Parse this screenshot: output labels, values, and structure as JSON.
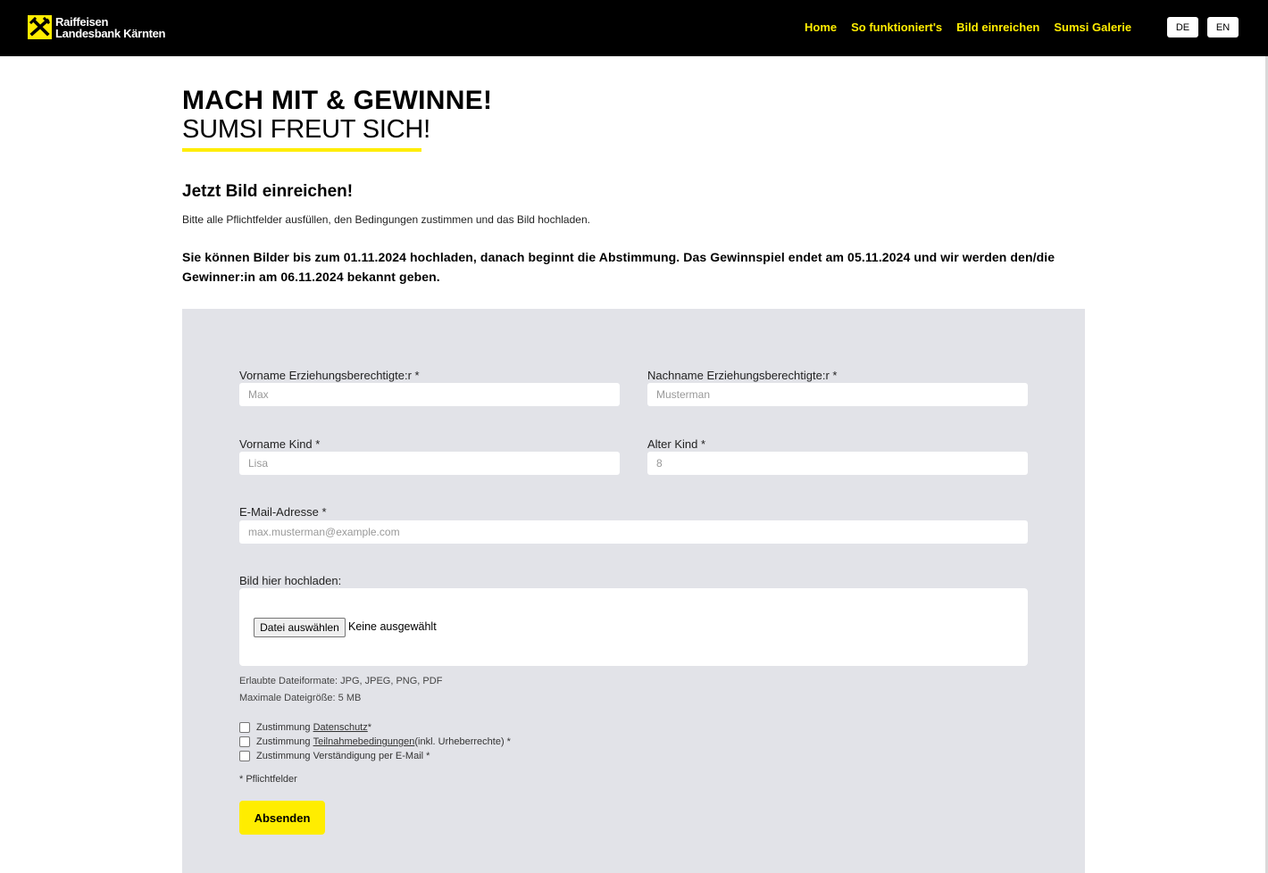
{
  "header": {
    "logo_line1": "Raiffeisen",
    "logo_line2": "Landesbank Kärnten",
    "nav": [
      "Home",
      "So funktioniert's",
      "Bild einreichen",
      "Sumsi Galerie"
    ],
    "lang_de": "DE",
    "lang_en": "EN",
    "accent_color": "#ffed00"
  },
  "hero": {
    "title": "MACH MIT & GEWINNE!",
    "subtitle": "SUMSI FREUT SICH!"
  },
  "section": {
    "title": "Jetzt Bild einreichen!",
    "intro": "Bitte alle Pflichtfelder ausfüllen, den Bedingungen zustimmen und das Bild hochladen.",
    "notice": "Sie können Bilder bis zum 01.11.2024 hochladen, danach beginnt die Abstimmung. Das Gewinnspiel endet am 05.11.2024 und wir werden den/die Gewinner:in am 06.11.2024 bekannt geben."
  },
  "form": {
    "parent_first_label": "Vorname Erziehungsberechtigte:r *",
    "parent_first_placeholder": "Max",
    "parent_last_label": "Nachname Erziehungsberechtigte:r *",
    "parent_last_placeholder": "Musterman",
    "child_first_label": "Vorname Kind *",
    "child_first_placeholder": "Lisa",
    "child_age_label": "Alter Kind *",
    "child_age_placeholder": "8",
    "email_label": "E-Mail-Adresse *",
    "email_placeholder": "max.musterman@example.com",
    "upload_label": "Bild hier hochladen:",
    "file_button": "Datei auswählen",
    "file_none": "Keine ausgewählt",
    "formats_hint": "Erlaubte Dateiformate: JPG, JPEG, PNG, PDF",
    "size_hint": "Maximale Dateigröße: 5 MB",
    "consent_privacy_prefix": "Zustimmung ",
    "consent_privacy_link": "Datenschutz",
    "consent_privacy_suffix": " *",
    "consent_terms_prefix": "Zustimmung ",
    "consent_terms_link": "Teilnahmebedingungen",
    "consent_terms_suffix": " (inkl. Urheberrechte) *",
    "consent_email": "Zustimmung Verständigung per E-Mail *",
    "required_note": "* Pflichtfelder",
    "submit": "Absenden"
  }
}
